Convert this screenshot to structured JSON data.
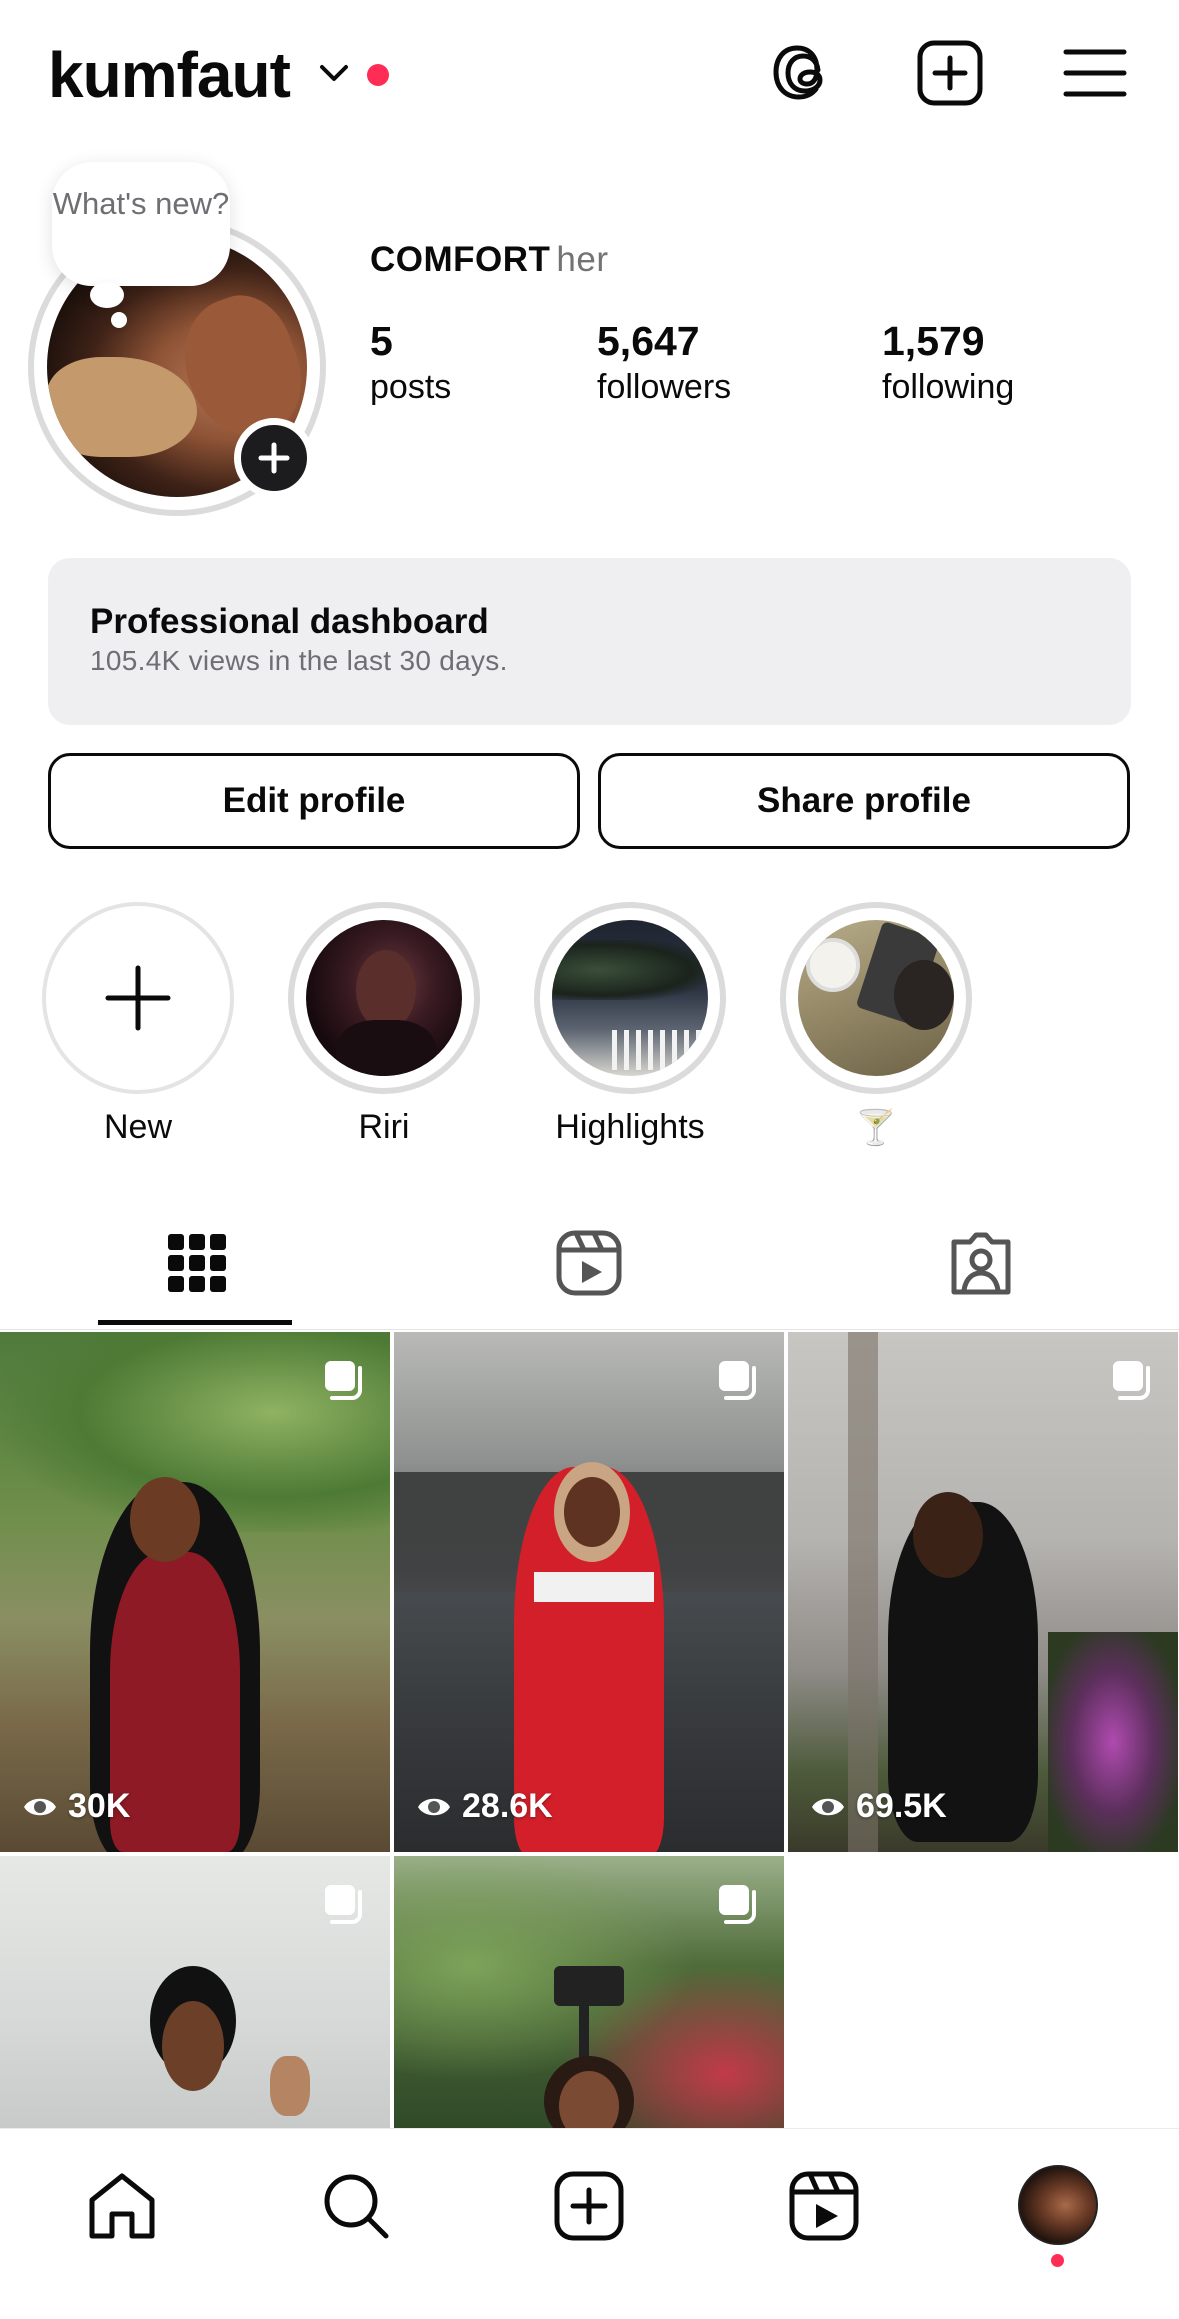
{
  "header": {
    "username": "kumfaut",
    "icons": [
      "chevron-down-icon",
      "threads-icon",
      "create-icon",
      "menu-icon"
    ],
    "notification_dot_color": "#ff2d55"
  },
  "profile": {
    "bubble_text": "What's new?",
    "display_name": "COMFORT",
    "pronoun": "her",
    "stats": [
      {
        "value": "5",
        "label": "posts"
      },
      {
        "value": "5,647",
        "label": "followers"
      },
      {
        "value": "1,579",
        "label": "following"
      }
    ]
  },
  "dashboard": {
    "title": "Professional dashboard",
    "subtitle": "105.4K views in the last 30 days."
  },
  "buttons": {
    "edit": "Edit profile",
    "share": "Share profile"
  },
  "highlights": [
    {
      "label": "New"
    },
    {
      "label": "Riri"
    },
    {
      "label": "Highlights"
    },
    {
      "label": "🍸"
    }
  ],
  "tabs": [
    "grid-icon",
    "reels-icon",
    "tagged-icon"
  ],
  "posts": [
    {
      "views": "30K"
    },
    {
      "views": "28.6K"
    },
    {
      "views": "69.5K"
    },
    {
      "views": ""
    },
    {
      "views": ""
    }
  ],
  "bottom_nav": [
    "home-icon",
    "search-icon",
    "create-icon",
    "reels-icon",
    "profile-avatar"
  ]
}
